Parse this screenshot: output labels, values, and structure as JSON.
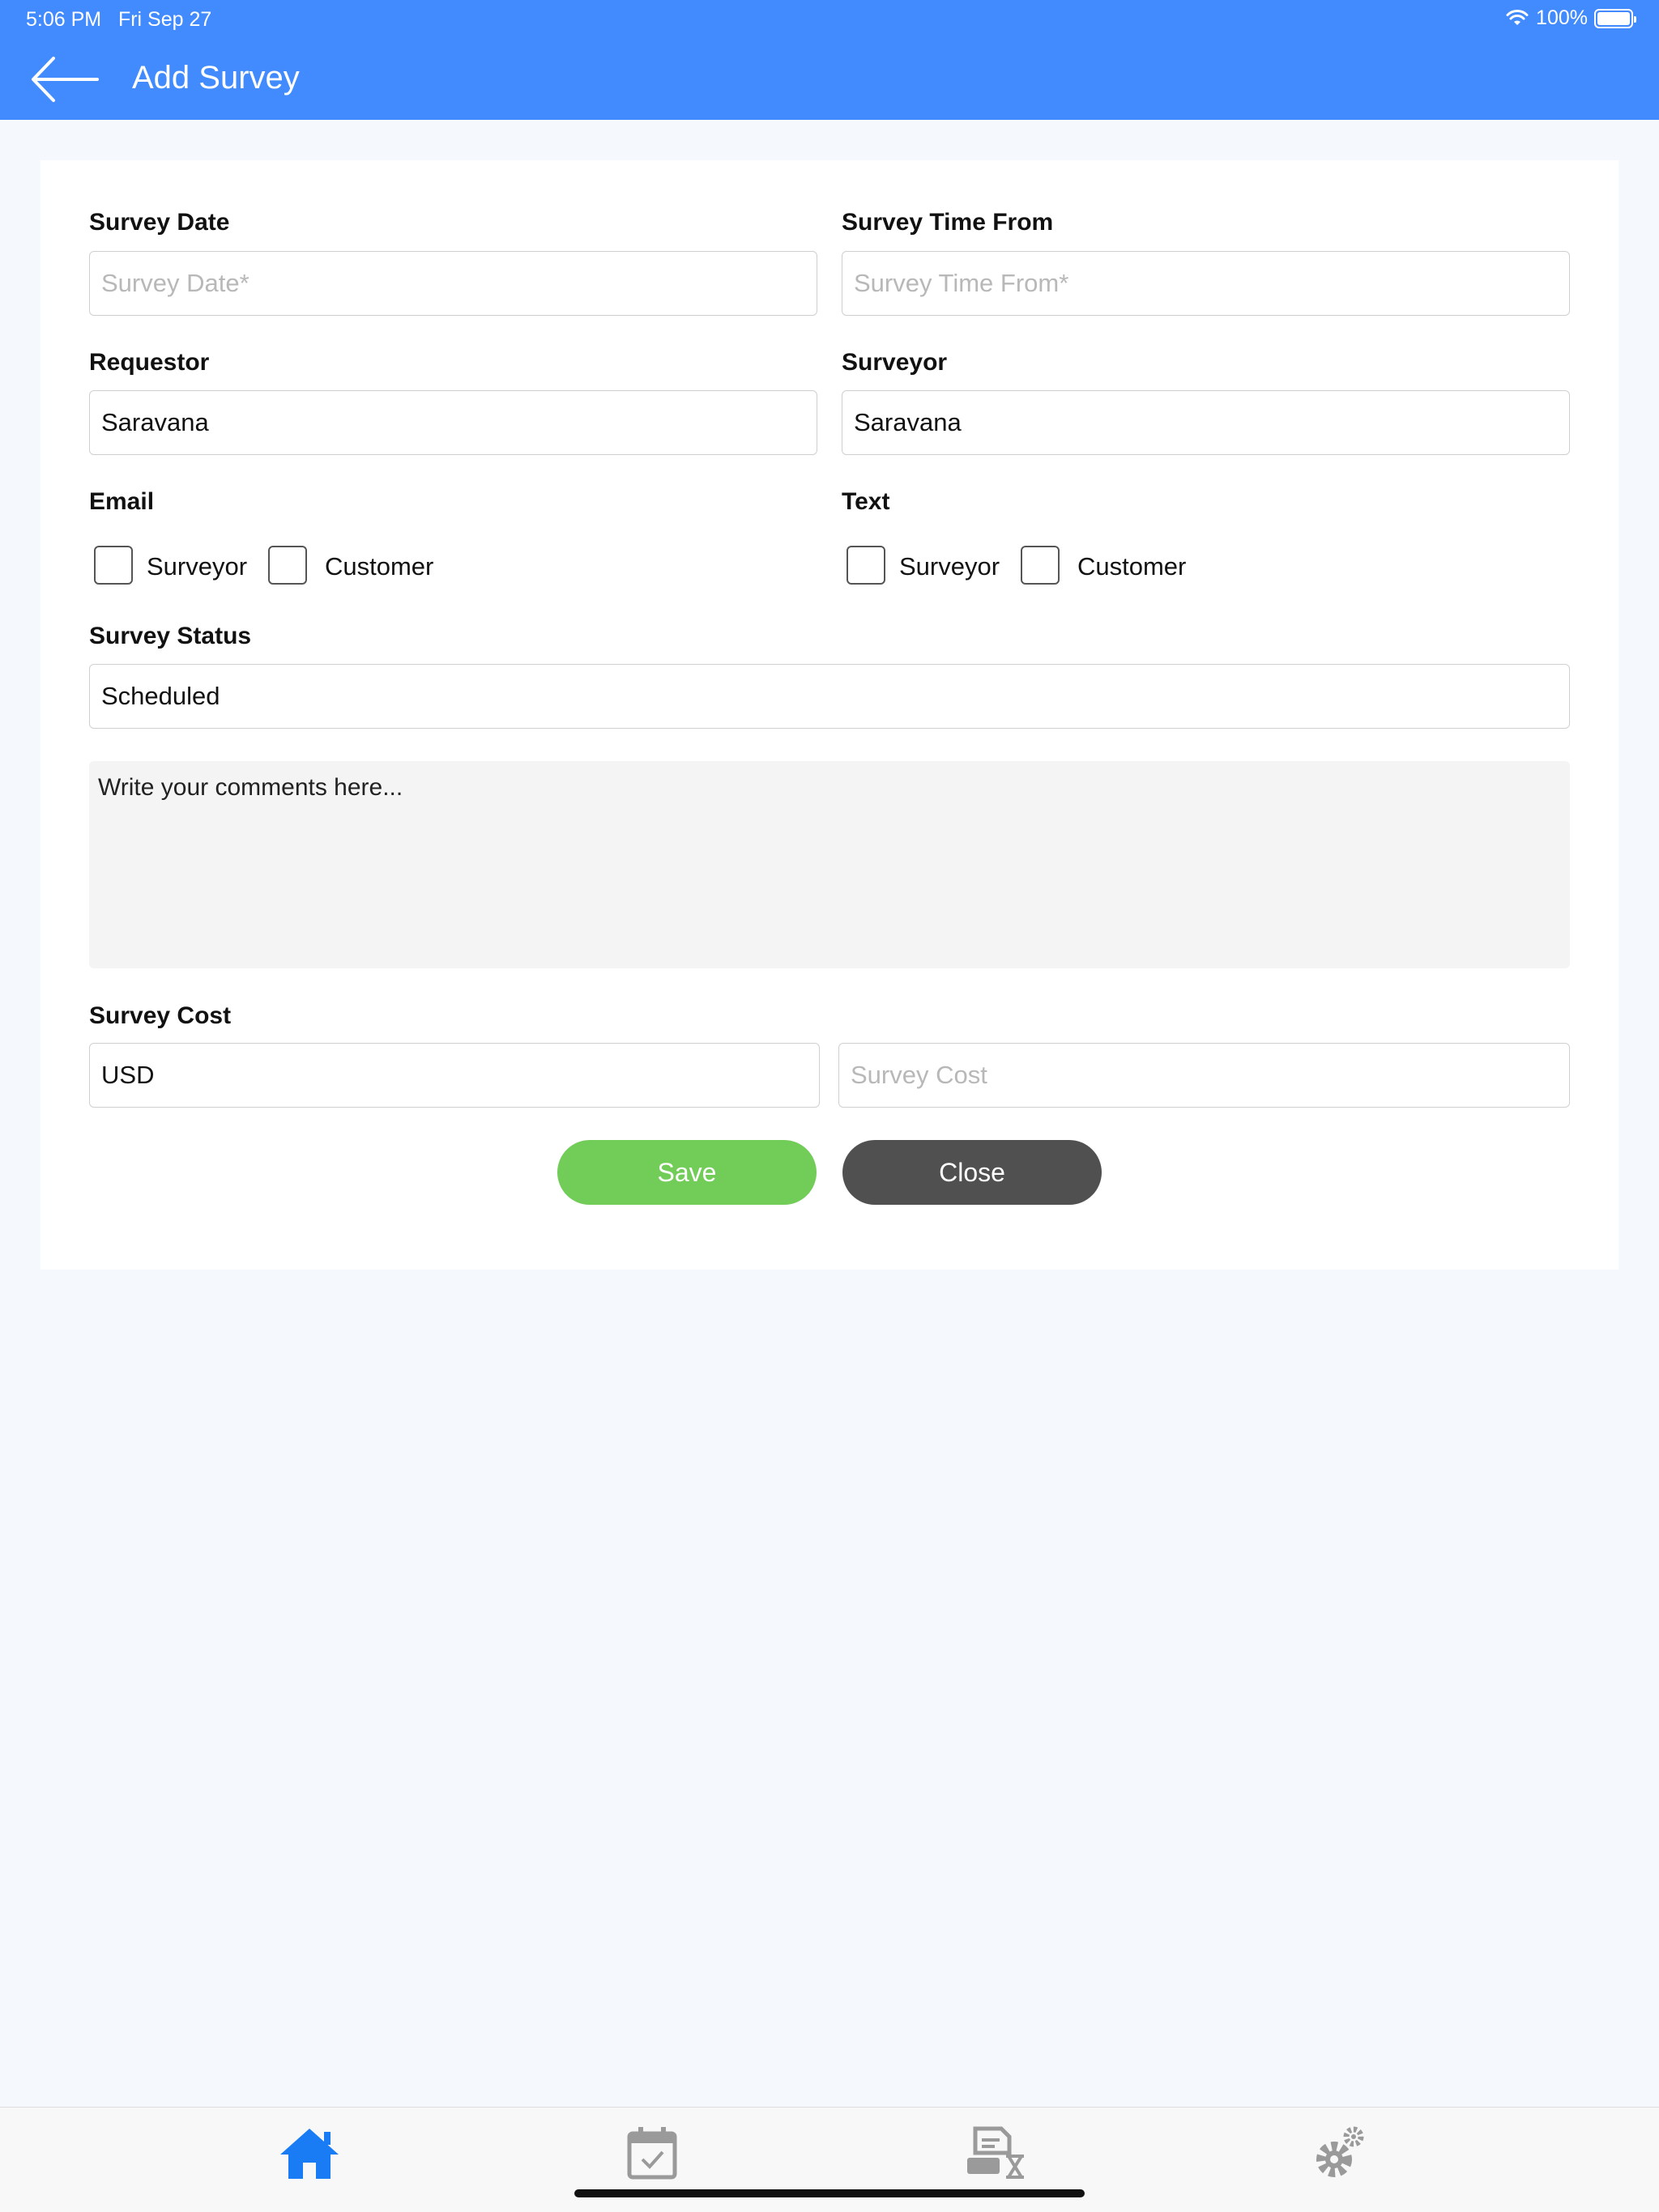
{
  "status_bar": {
    "time": "5:06 PM",
    "date": "Fri Sep 27",
    "battery": "100%"
  },
  "nav": {
    "title": "Add Survey"
  },
  "form": {
    "survey_date": {
      "label": "Survey Date",
      "placeholder": "Survey Date*",
      "value": ""
    },
    "survey_time_from": {
      "label": "Survey Time From",
      "placeholder": "Survey Time From*",
      "value": ""
    },
    "requestor": {
      "label": "Requestor",
      "value": "Saravana"
    },
    "surveyor": {
      "label": "Surveyor",
      "value": "Saravana"
    },
    "email": {
      "label": "Email",
      "options": [
        "Surveyor",
        "Customer"
      ]
    },
    "text": {
      "label": "Text",
      "options": [
        "Surveyor",
        "Customer"
      ]
    },
    "survey_status": {
      "label": "Survey Status",
      "value": "Scheduled"
    },
    "comments": {
      "placeholder": "Write your comments here..."
    },
    "survey_cost": {
      "label": "Survey Cost",
      "currency": "USD",
      "placeholder": "Survey Cost"
    },
    "save_label": "Save",
    "close_label": "Close"
  },
  "colors": {
    "header": "#428bfe",
    "save": "#72cc58",
    "close": "#505050",
    "active_tab": "#1a7cf5",
    "inactive_tab": "#9a9a9a"
  },
  "tabs": [
    {
      "icon": "home-icon",
      "active": true
    },
    {
      "icon": "calendar-check-icon",
      "active": false
    },
    {
      "icon": "pending-tasks-icon",
      "active": false
    },
    {
      "icon": "settings-icon",
      "active": false
    }
  ]
}
